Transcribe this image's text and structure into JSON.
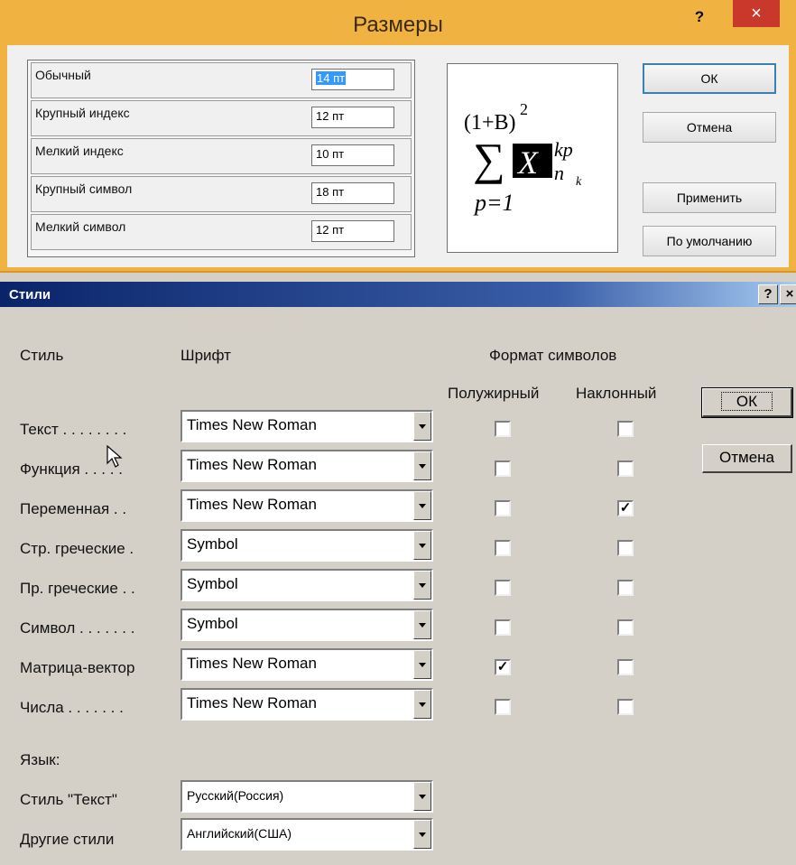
{
  "sizes_dialog": {
    "title": "Размеры",
    "help": "?",
    "close": "×",
    "rows": [
      {
        "label": "Обычный",
        "value": "14 пт"
      },
      {
        "label": "Крупный индекс",
        "value": "12 пт"
      },
      {
        "label": "Мелкий индекс",
        "value": "10 пт"
      },
      {
        "label": "Крупный символ",
        "value": "18 пт"
      },
      {
        "label": "Мелкий символ",
        "value": "12 пт"
      }
    ],
    "preview": {
      "top": "(1+B)",
      "top_exp": "2",
      "sum": "∑",
      "x": "X",
      "sup": "kp",
      "sub_n": "n",
      "sub_k": "k",
      "bottom": "p=1"
    },
    "buttons": {
      "ok": "ОК",
      "cancel": "Отмена",
      "apply": "Применить",
      "default": "По умолчанию"
    }
  },
  "styles_dialog": {
    "title": "Стили",
    "help": "?",
    "close": "×",
    "headers": {
      "style": "Стиль",
      "font": "Шрифт",
      "format": "Формат символов",
      "bold": "Полужирный",
      "italic": "Наклонный"
    },
    "rows": [
      {
        "label": "Текст . . . . . . . .",
        "font": "Times New Roman",
        "bold": false,
        "italic": false
      },
      {
        "label": "Функция . . . . .",
        "font": "Times New Roman",
        "bold": false,
        "italic": false
      },
      {
        "label": "Переменная . .",
        "font": "Times New Roman",
        "bold": false,
        "italic": true
      },
      {
        "label": "Стр. греческие .",
        "font": "Symbol",
        "bold": false,
        "italic": false
      },
      {
        "label": "Пр. греческие . .",
        "font": "Symbol",
        "bold": false,
        "italic": false
      },
      {
        "label": "Символ . . . . . . .",
        "font": "Symbol",
        "bold": false,
        "italic": false
      },
      {
        "label": "Матрица-вектор",
        "font": "Times New Roman",
        "bold": true,
        "italic": false
      },
      {
        "label": "Числа . . . . . . .",
        "font": "Times New Roman",
        "bold": false,
        "italic": false
      }
    ],
    "language_label": "Язык:",
    "language_rows": [
      {
        "label": "Стиль \"Текст\"",
        "value": "Русский(Россия)"
      },
      {
        "label": "Другие стили",
        "value": "Английский(США)"
      }
    ],
    "buttons": {
      "ok": "ОК",
      "cancel": "Отмена"
    },
    "check_mark": "✓"
  }
}
